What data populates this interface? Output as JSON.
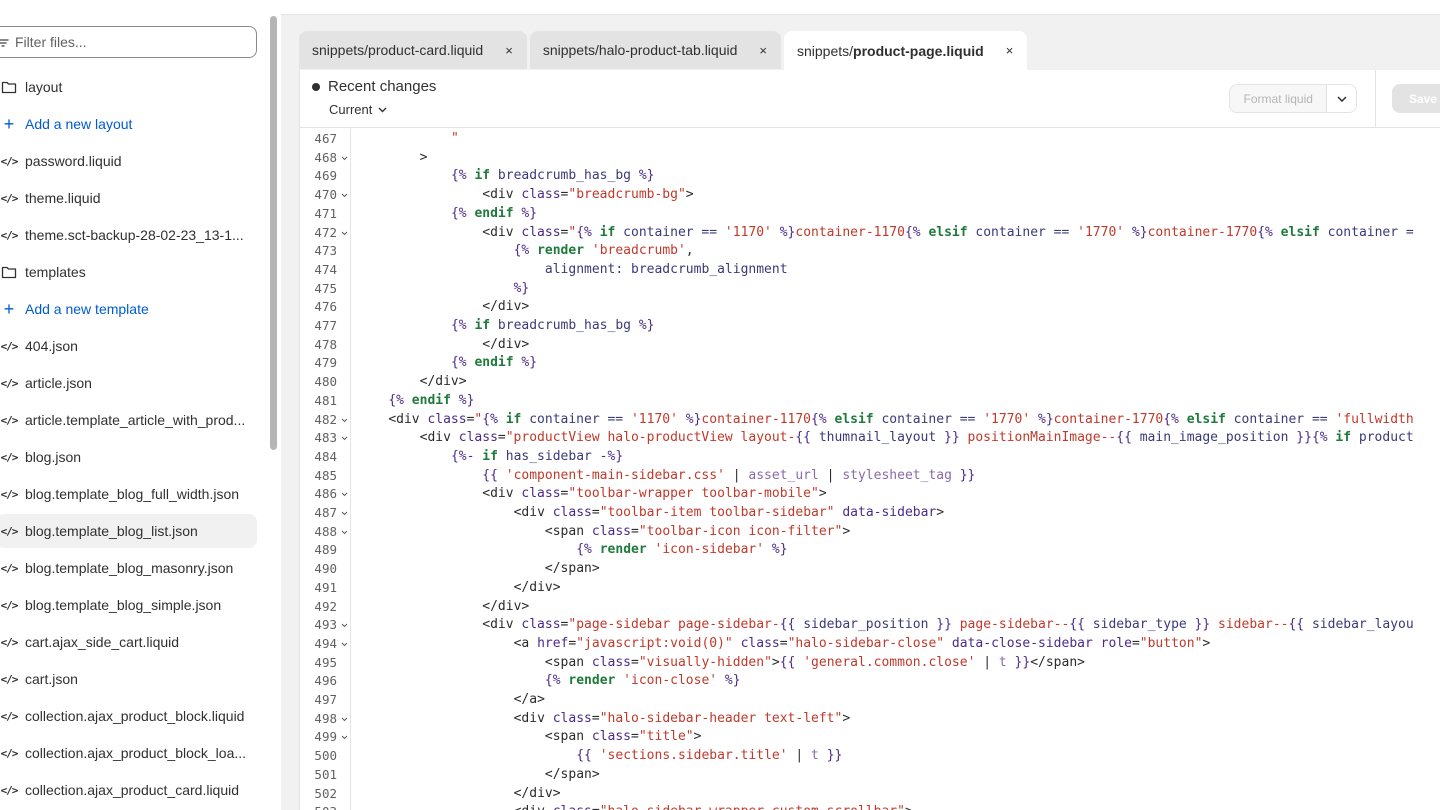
{
  "sidebar": {
    "filter_placeholder": "Filter files...",
    "items": [
      {
        "type": "folder",
        "label": "layout"
      },
      {
        "type": "add",
        "label": "Add a new layout"
      },
      {
        "type": "file",
        "label": "password.liquid"
      },
      {
        "type": "file",
        "label": "theme.liquid"
      },
      {
        "type": "file",
        "label": "theme.sct-backup-28-02-23_13-1..."
      },
      {
        "type": "folder",
        "label": "templates"
      },
      {
        "type": "add",
        "label": "Add a new template"
      },
      {
        "type": "file",
        "label": "404.json"
      },
      {
        "type": "file",
        "label": "article.json"
      },
      {
        "type": "file",
        "label": "article.template_article_with_prod..."
      },
      {
        "type": "file",
        "label": "blog.json"
      },
      {
        "type": "file",
        "label": "blog.template_blog_full_width.json"
      },
      {
        "type": "file",
        "label": "blog.template_blog_list.json",
        "selected": true
      },
      {
        "type": "file",
        "label": "blog.template_blog_masonry.json"
      },
      {
        "type": "file",
        "label": "blog.template_blog_simple.json"
      },
      {
        "type": "file",
        "label": "cart.ajax_side_cart.liquid"
      },
      {
        "type": "file",
        "label": "cart.json"
      },
      {
        "type": "file",
        "label": "collection.ajax_product_block.liquid"
      },
      {
        "type": "file",
        "label": "collection.ajax_product_block_loa..."
      },
      {
        "type": "file",
        "label": "collection.ajax_product_card.liquid"
      }
    ]
  },
  "tabs": [
    {
      "prefix": "snippets/product-card.liquid",
      "bold": "",
      "close": "×"
    },
    {
      "prefix": "snippets/halo-product-tab.liquid",
      "bold": "",
      "close": "×"
    },
    {
      "prefix": "snippets/",
      "bold": "product-page.liquid",
      "close": "×",
      "active": true
    }
  ],
  "editor": {
    "recent_changes": "Recent changes",
    "current": "Current",
    "format_label": "Format liquid",
    "save_label": "Save"
  },
  "code_lines": [
    {
      "n": "467",
      "fold": false,
      "i": 12,
      "segs": [
        [
          "s",
          "\""
        ]
      ]
    },
    {
      "n": "468",
      "fold": true,
      "i": 8,
      "segs": [
        [
          "",
          ">"
        ]
      ]
    },
    {
      "n": "469",
      "fold": false,
      "i": 12,
      "segs": [
        [
          "p",
          "{% "
        ],
        [
          "k",
          "if"
        ],
        [
          "v",
          " breadcrumb_has_bg "
        ],
        [
          "p",
          "%}"
        ]
      ]
    },
    {
      "n": "470",
      "fold": true,
      "i": 16,
      "segs": [
        [
          "",
          "<div "
        ],
        [
          "t",
          "class"
        ],
        [
          "",
          "="
        ],
        [
          "s",
          "\"breadcrumb-bg\""
        ],
        [
          "",
          ">"
        ]
      ]
    },
    {
      "n": "471",
      "fold": false,
      "i": 12,
      "segs": [
        [
          "p",
          "{% "
        ],
        [
          "k",
          "endif"
        ],
        [
          "p",
          " %}"
        ]
      ]
    },
    {
      "n": "472",
      "fold": true,
      "i": 16,
      "segs": [
        [
          "",
          "<div "
        ],
        [
          "t",
          "class"
        ],
        [
          "",
          "="
        ],
        [
          "s",
          "\""
        ],
        [
          "p",
          "{% "
        ],
        [
          "k",
          "if"
        ],
        [
          "v",
          " container == "
        ],
        [
          "s",
          "'1170'"
        ],
        [
          "p",
          " %}"
        ],
        [
          "s",
          "container-1170"
        ],
        [
          "p",
          "{% "
        ],
        [
          "k",
          "elsif"
        ],
        [
          "v",
          " container == "
        ],
        [
          "s",
          "'1770'"
        ],
        [
          "p",
          " %}"
        ],
        [
          "s",
          "container-1770"
        ],
        [
          "p",
          "{% "
        ],
        [
          "k",
          "elsif"
        ],
        [
          "v",
          " container = "
        ]
      ]
    },
    {
      "n": "473",
      "fold": false,
      "i": 20,
      "segs": [
        [
          "p",
          "{% "
        ],
        [
          "k",
          "render"
        ],
        [
          "s",
          " 'breadcrumb'"
        ],
        [
          "",
          ","
        ]
      ]
    },
    {
      "n": "474",
      "fold": false,
      "i": 24,
      "segs": [
        [
          "v",
          "alignment: breadcrumb_alignment"
        ]
      ]
    },
    {
      "n": "475",
      "fold": false,
      "i": 20,
      "segs": [
        [
          "p",
          "%}"
        ]
      ]
    },
    {
      "n": "476",
      "fold": false,
      "i": 16,
      "segs": [
        [
          "",
          "</div>"
        ]
      ]
    },
    {
      "n": "477",
      "fold": false,
      "i": 12,
      "segs": [
        [
          "p",
          "{% "
        ],
        [
          "k",
          "if"
        ],
        [
          "v",
          " breadcrumb_has_bg "
        ],
        [
          "p",
          "%}"
        ]
      ]
    },
    {
      "n": "478",
      "fold": false,
      "i": 16,
      "segs": [
        [
          "",
          "</div>"
        ]
      ]
    },
    {
      "n": "479",
      "fold": false,
      "i": 12,
      "segs": [
        [
          "p",
          "{% "
        ],
        [
          "k",
          "endif"
        ],
        [
          "p",
          " %}"
        ]
      ]
    },
    {
      "n": "480",
      "fold": false,
      "i": 8,
      "segs": [
        [
          "",
          "</div>"
        ]
      ]
    },
    {
      "n": "481",
      "fold": false,
      "i": 4,
      "segs": [
        [
          "p",
          "{% "
        ],
        [
          "k",
          "endif"
        ],
        [
          "p",
          " %}"
        ]
      ]
    },
    {
      "n": "482",
      "fold": true,
      "i": 4,
      "segs": [
        [
          "",
          "<div "
        ],
        [
          "t",
          "class"
        ],
        [
          "",
          "="
        ],
        [
          "s",
          "\""
        ],
        [
          "p",
          "{% "
        ],
        [
          "k",
          "if"
        ],
        [
          "v",
          " container == "
        ],
        [
          "s",
          "'1170'"
        ],
        [
          "p",
          " %}"
        ],
        [
          "s",
          "container-1170"
        ],
        [
          "p",
          "{% "
        ],
        [
          "k",
          "elsif"
        ],
        [
          "v",
          " container == "
        ],
        [
          "s",
          "'1770'"
        ],
        [
          "p",
          " %}"
        ],
        [
          "s",
          "container-1770"
        ],
        [
          "p",
          "{% "
        ],
        [
          "k",
          "elsif"
        ],
        [
          "v",
          " container == "
        ],
        [
          "s",
          "'fullwidth"
        ]
      ]
    },
    {
      "n": "483",
      "fold": true,
      "i": 8,
      "segs": [
        [
          "",
          "<div "
        ],
        [
          "t",
          "class"
        ],
        [
          "",
          "="
        ],
        [
          "s",
          "\"productView halo-productView layout-"
        ],
        [
          "p",
          "{{ "
        ],
        [
          "v",
          "thumnail_layout"
        ],
        [
          "p",
          " }}"
        ],
        [
          "s",
          " positionMainImage--"
        ],
        [
          "p",
          "{{ "
        ],
        [
          "v",
          "main_image_position"
        ],
        [
          "p",
          " }}"
        ],
        [
          "p",
          "{% "
        ],
        [
          "k",
          "if"
        ],
        [
          "v",
          " product"
        ]
      ]
    },
    {
      "n": "484",
      "fold": false,
      "i": 12,
      "segs": [
        [
          "p",
          "{%- "
        ],
        [
          "k",
          "if"
        ],
        [
          "v",
          " has_sidebar "
        ],
        [
          "p",
          "-%}"
        ]
      ]
    },
    {
      "n": "485",
      "fold": false,
      "i": 16,
      "segs": [
        [
          "p",
          "{{ "
        ],
        [
          "s",
          "'component-main-sidebar.css'"
        ],
        [
          "",
          " | "
        ],
        [
          "f",
          "asset_url"
        ],
        [
          "",
          " | "
        ],
        [
          "f",
          "stylesheet_tag"
        ],
        [
          "p",
          " }}"
        ]
      ]
    },
    {
      "n": "486",
      "fold": true,
      "i": 16,
      "segs": [
        [
          "",
          "<div "
        ],
        [
          "t",
          "class"
        ],
        [
          "",
          "="
        ],
        [
          "s",
          "\"toolbar-wrapper toolbar-mobile\""
        ],
        [
          "",
          ">"
        ]
      ]
    },
    {
      "n": "487",
      "fold": true,
      "i": 20,
      "segs": [
        [
          "",
          "<div "
        ],
        [
          "t",
          "class"
        ],
        [
          "",
          "="
        ],
        [
          "s",
          "\"toolbar-item toolbar-sidebar\""
        ],
        [
          "t",
          " data-sidebar"
        ],
        [
          "",
          ">"
        ]
      ]
    },
    {
      "n": "488",
      "fold": true,
      "i": 24,
      "segs": [
        [
          "",
          "<span "
        ],
        [
          "t",
          "class"
        ],
        [
          "",
          "="
        ],
        [
          "s",
          "\"toolbar-icon icon-filter\""
        ],
        [
          "",
          ">"
        ]
      ]
    },
    {
      "n": "489",
      "fold": false,
      "i": 28,
      "segs": [
        [
          "p",
          "{% "
        ],
        [
          "k",
          "render"
        ],
        [
          "s",
          " 'icon-sidebar'"
        ],
        [
          "p",
          " %}"
        ]
      ]
    },
    {
      "n": "490",
      "fold": false,
      "i": 24,
      "segs": [
        [
          "",
          "</span>"
        ]
      ]
    },
    {
      "n": "491",
      "fold": false,
      "i": 20,
      "segs": [
        [
          "",
          "</div>"
        ]
      ]
    },
    {
      "n": "492",
      "fold": false,
      "i": 16,
      "segs": [
        [
          "",
          "</div>"
        ]
      ]
    },
    {
      "n": "493",
      "fold": true,
      "i": 16,
      "segs": [
        [
          "",
          "<div "
        ],
        [
          "t",
          "class"
        ],
        [
          "",
          "="
        ],
        [
          "s",
          "\"page-sidebar page-sidebar-"
        ],
        [
          "p",
          "{{ "
        ],
        [
          "v",
          "sidebar_position"
        ],
        [
          "p",
          " }}"
        ],
        [
          "s",
          " page-sidebar--"
        ],
        [
          "p",
          "{{ "
        ],
        [
          "v",
          "sidebar_type"
        ],
        [
          "p",
          " }}"
        ],
        [
          "s",
          " sidebar--"
        ],
        [
          "p",
          "{{ "
        ],
        [
          "v",
          "sidebar_layou"
        ]
      ]
    },
    {
      "n": "494",
      "fold": true,
      "i": 20,
      "segs": [
        [
          "",
          "<a "
        ],
        [
          "t",
          "href"
        ],
        [
          "",
          "="
        ],
        [
          "s",
          "\"javascript:void(0)\""
        ],
        [
          "t",
          " class"
        ],
        [
          "",
          "="
        ],
        [
          "s",
          "\"halo-sidebar-close\""
        ],
        [
          "t",
          " data-close-sidebar role"
        ],
        [
          "",
          "="
        ],
        [
          "s",
          "\"button\""
        ],
        [
          "",
          ">"
        ]
      ]
    },
    {
      "n": "495",
      "fold": false,
      "i": 24,
      "segs": [
        [
          "",
          "<span "
        ],
        [
          "t",
          "class"
        ],
        [
          "",
          "="
        ],
        [
          "s",
          "\"visually-hidden\""
        ],
        [
          "",
          ">"
        ],
        [
          "p",
          "{{ "
        ],
        [
          "s",
          "'general.common.close'"
        ],
        [
          "",
          " | "
        ],
        [
          "f",
          "t"
        ],
        [
          "p",
          " }}"
        ],
        [
          "",
          "</span>"
        ]
      ]
    },
    {
      "n": "496",
      "fold": false,
      "i": 24,
      "segs": [
        [
          "p",
          "{% "
        ],
        [
          "k",
          "render"
        ],
        [
          "s",
          " 'icon-close'"
        ],
        [
          "p",
          " %}"
        ]
      ]
    },
    {
      "n": "497",
      "fold": false,
      "i": 20,
      "segs": [
        [
          "",
          "</a>"
        ]
      ]
    },
    {
      "n": "498",
      "fold": true,
      "i": 20,
      "segs": [
        [
          "",
          "<div "
        ],
        [
          "t",
          "class"
        ],
        [
          "",
          "="
        ],
        [
          "s",
          "\"halo-sidebar-header text-left\""
        ],
        [
          "",
          ">"
        ]
      ]
    },
    {
      "n": "499",
      "fold": true,
      "i": 24,
      "segs": [
        [
          "",
          "<span "
        ],
        [
          "t",
          "class"
        ],
        [
          "",
          "="
        ],
        [
          "s",
          "\"title\""
        ],
        [
          "",
          ">"
        ]
      ]
    },
    {
      "n": "500",
      "fold": false,
      "i": 28,
      "segs": [
        [
          "p",
          "{{ "
        ],
        [
          "s",
          "'sections.sidebar.title'"
        ],
        [
          "",
          " | "
        ],
        [
          "f",
          "t"
        ],
        [
          "p",
          " }}"
        ]
      ]
    },
    {
      "n": "501",
      "fold": false,
      "i": 24,
      "segs": [
        [
          "",
          "</span>"
        ]
      ]
    },
    {
      "n": "502",
      "fold": false,
      "i": 20,
      "segs": [
        [
          "",
          "</div>"
        ]
      ]
    },
    {
      "n": "503",
      "fold": false,
      "i": 20,
      "segs": [
        [
          "",
          "<div "
        ],
        [
          "t",
          "class"
        ],
        [
          "",
          "="
        ],
        [
          "s",
          "\"halo-sidebar-wrapper custom-scrollbar\""
        ],
        [
          "",
          ">"
        ]
      ]
    }
  ]
}
